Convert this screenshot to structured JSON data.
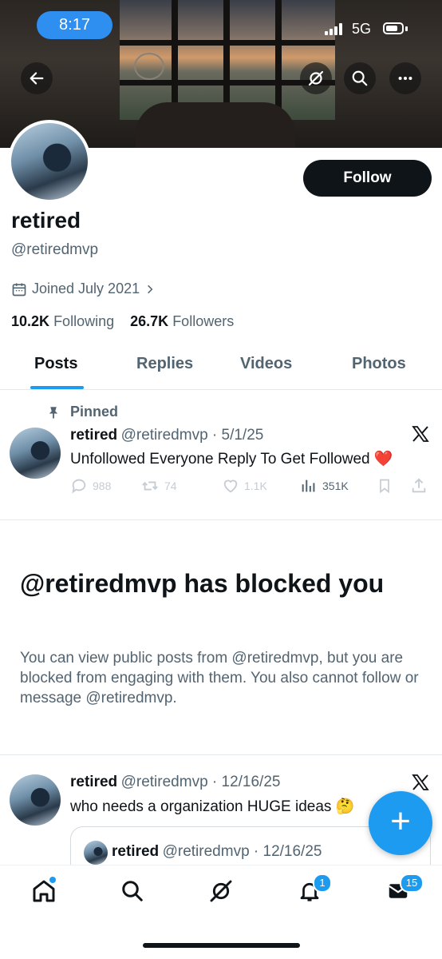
{
  "status_bar": {
    "time": "8:17",
    "network": "5G"
  },
  "profile": {
    "name": "retired",
    "handle": "@retiredmvp",
    "joined": "Joined July 2021",
    "following_count": "10.2K",
    "following_label": "Following",
    "followers_count": "26.7K",
    "followers_label": "Followers",
    "follow_label": "Follow"
  },
  "tabs": [
    "Posts",
    "Replies",
    "Videos",
    "Photos"
  ],
  "pinned_post": {
    "pinned_label": "Pinned",
    "name": "retired",
    "meta": "@retiredmvp · 5/1/25",
    "text": "Unfollowed Everyone Reply To Get Followed",
    "emoji": "❤️",
    "replies": "988",
    "reposts": "74",
    "likes": "1.1K",
    "views": "351K"
  },
  "blocked": {
    "title": "@retiredmvp has blocked you",
    "text": "You can view public posts from @retiredmvp, but you are blocked from engaging with them. You also cannot follow or message @retiredmvp."
  },
  "post2": {
    "name": "retired",
    "meta": "@retiredmvp · 12/16/25",
    "text": "who needs a organization HUGE ideas",
    "emoji": "🤔",
    "quote_name": "retired",
    "quote_meta": "@retiredmvp · 12/16/25"
  },
  "nav": {
    "notifications_badge": "1",
    "messages_badge": "15"
  },
  "colors": {
    "accent": "#1d9bf0",
    "text": "#0f1419",
    "muted": "#536471"
  }
}
